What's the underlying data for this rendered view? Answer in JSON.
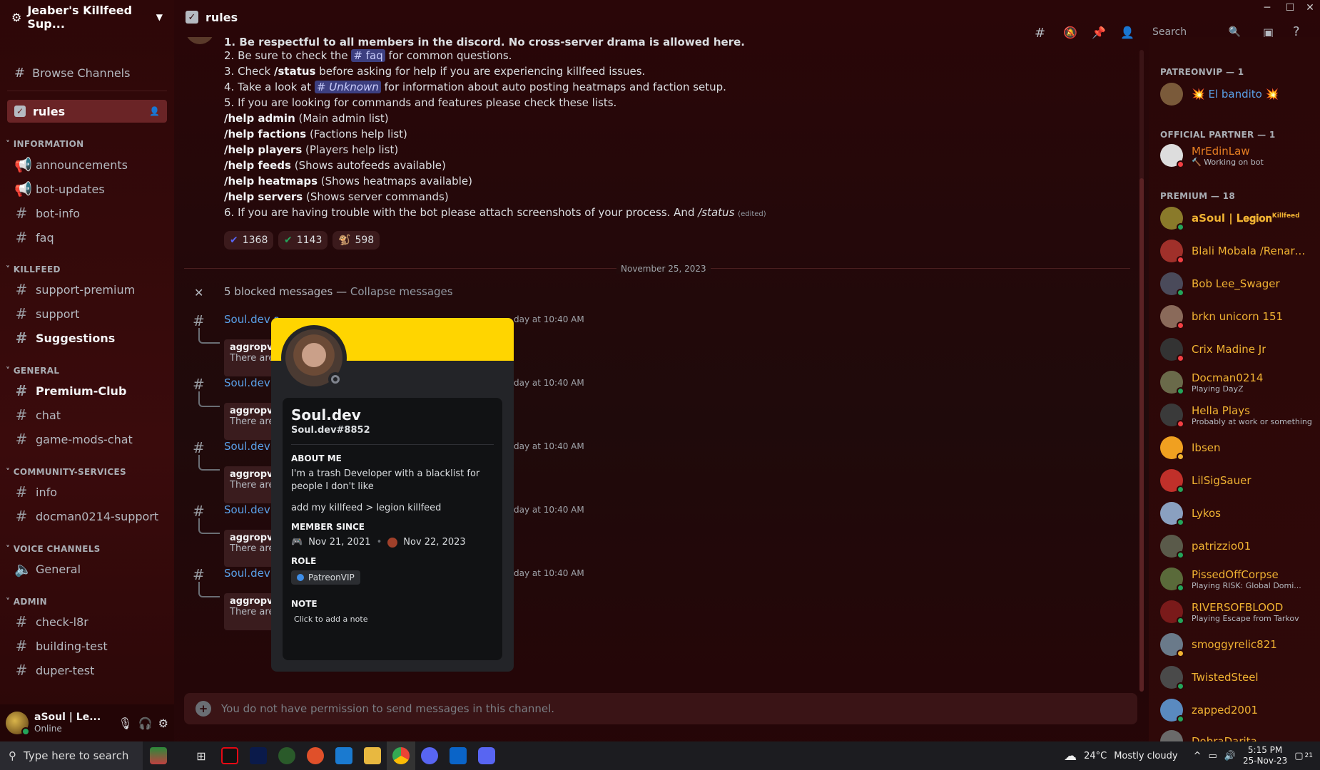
{
  "server": {
    "name": "Jeaber's Killfeed Sup...",
    "browse": "Browse Channels"
  },
  "active_channel": "rules",
  "categories": {
    "information": "INFORMATION",
    "killfeed": "KILLFEED",
    "general": "GENERAL",
    "community": "COMMUNITY-SERVICES",
    "voice": "VOICE CHANNELS",
    "admin": "ADMIN"
  },
  "channels": {
    "announcements": "announcements",
    "bot_updates": "bot-updates",
    "bot_info": "bot-info",
    "faq": "faq",
    "support_premium": "support-premium",
    "support": "support",
    "suggestions": "Suggestions",
    "premium_club": "Premium-Club",
    "chat": "chat",
    "game_mods_chat": "game-mods-chat",
    "info": "info",
    "docman": "docman0214-support",
    "general_voice": "General",
    "check_l8r": "check-l8r",
    "building_test": "building-test",
    "duper_test": "duper-test"
  },
  "user": {
    "name": "aSoul | Le...",
    "status": "Online"
  },
  "search_placeholder": "Search",
  "rules": {
    "l1": "1. Be respectful to all members in the discord. No cross-server drama is allowed here.",
    "l2a": "2. Be sure to check the ",
    "l2m": "# faq",
    "l2b": " for common questions.",
    "l3a": "3. Check ",
    "l3c": "/status",
    "l3b": " before asking for help if you are experiencing killfeed issues.",
    "l4a": "4. Take a look at ",
    "l4m": "# Unknown",
    "l4b": " for information about auto posting heatmaps and faction setup.",
    "l5": "5. If you are looking for commands and features please check these lists.",
    "h1c": "/help admin",
    "h1t": " (Main admin list)",
    "h2c": "/help factions",
    "h2t": " (Factions help list)",
    "h3c": "/help players",
    "h3t": " (Players help list)",
    "h4c": "/help feeds",
    "h4t": " (Shows autofeeds available)",
    "h5c": "/help heatmaps",
    "h5t": " (Shows heatmaps available)",
    "h6c": "/help servers",
    "h6t": " (Shows server commands)",
    "l6a": "6. If you are having trouble with the bot please attach screenshots of your process. And ",
    "l6c": "/status",
    "l6e": "(edited)"
  },
  "reactions": [
    {
      "count": "1368"
    },
    {
      "count": "1143"
    },
    {
      "count": "598"
    }
  ],
  "date_divider": "November 25, 2023",
  "blocked": {
    "text": "5 blocked messages — ",
    "link": "Collapse messages"
  },
  "blocked_msgs": [
    {
      "author": "Soul.dev s",
      "time": "day at 10:40 AM",
      "title": "aggropvp.",
      "sub": "There are"
    },
    {
      "author": "Soul.dev s",
      "time": "day at 10:40 AM",
      "title": "aggropvp.",
      "sub": "There are"
    },
    {
      "author": "Soul.dev s",
      "time": "day at 10:40 AM",
      "title": "aggropvp.",
      "sub": "There are"
    },
    {
      "author": "Soul.dev s",
      "time": "day at 10:40 AM",
      "title": "aggropvp.",
      "sub": "There are"
    },
    {
      "author": "Soul.dev s",
      "time": "day at 10:40 AM",
      "title": "aggropvp.",
      "sub": "There are"
    }
  ],
  "composer": "You do not have permission to send messages in this channel.",
  "profile": {
    "name": "Soul.dev",
    "tag": "Soul.dev#8852",
    "about_h": "ABOUT ME",
    "about1": "I'm a trash Developer with a blacklist for people I don't like",
    "about2": "add my killfeed > legion killfeed",
    "member_h": "MEMBER SINCE",
    "since_discord": "Nov 21, 2021",
    "since_server": "Nov 22, 2023",
    "role_h": "ROLE",
    "role": "PatreonVIP",
    "note_h": "NOTE",
    "note": "Click to add a note",
    "banner_color": "#ffd500"
  },
  "members": {
    "g1": "PATREONVIP — 1",
    "g2": "OFFICIAL PARTNER — 1",
    "g3": "PREMIUM — 18",
    "m1": "💥 El bandito 💥",
    "m2": "MrEdinLaw",
    "m2s": "🔨 Working on bot",
    "m3": "aSoul | 𝐋𝐞𝐠𝐢𝐨𝐧",
    "m3b": "Killfeed",
    "m4": "Blali Mobala /Renard...",
    "m5": "Bob Lee_Swager",
    "m6": "brkn unicorn 151",
    "m7": "Crix Madine Jr",
    "m8": "Docman0214",
    "m8s": "Playing DayZ",
    "m9": "Hella Plays",
    "m9s": "Probably at work or something!",
    "m10": "Ibsen",
    "m11": "LilSigSauer",
    "m12": "Lykos",
    "m13": "patrizzio01",
    "m14": "PissedOffCorpse",
    "m14s": "Playing RISK: Global Domi...",
    "m15": "RIVERSOFBLOOD",
    "m15s": "Playing Escape from Tarkov",
    "m16": "smoggyrelic821",
    "m17": "TwistedSteel",
    "m18": "zapped2001",
    "m19": "DobraDarita..."
  },
  "taskbar": {
    "search": "Type here to search",
    "weather_temp": "24°C",
    "weather": "Mostly cloudy",
    "time": "5:15 PM",
    "date": "25-Nov-23",
    "notif": "21"
  }
}
